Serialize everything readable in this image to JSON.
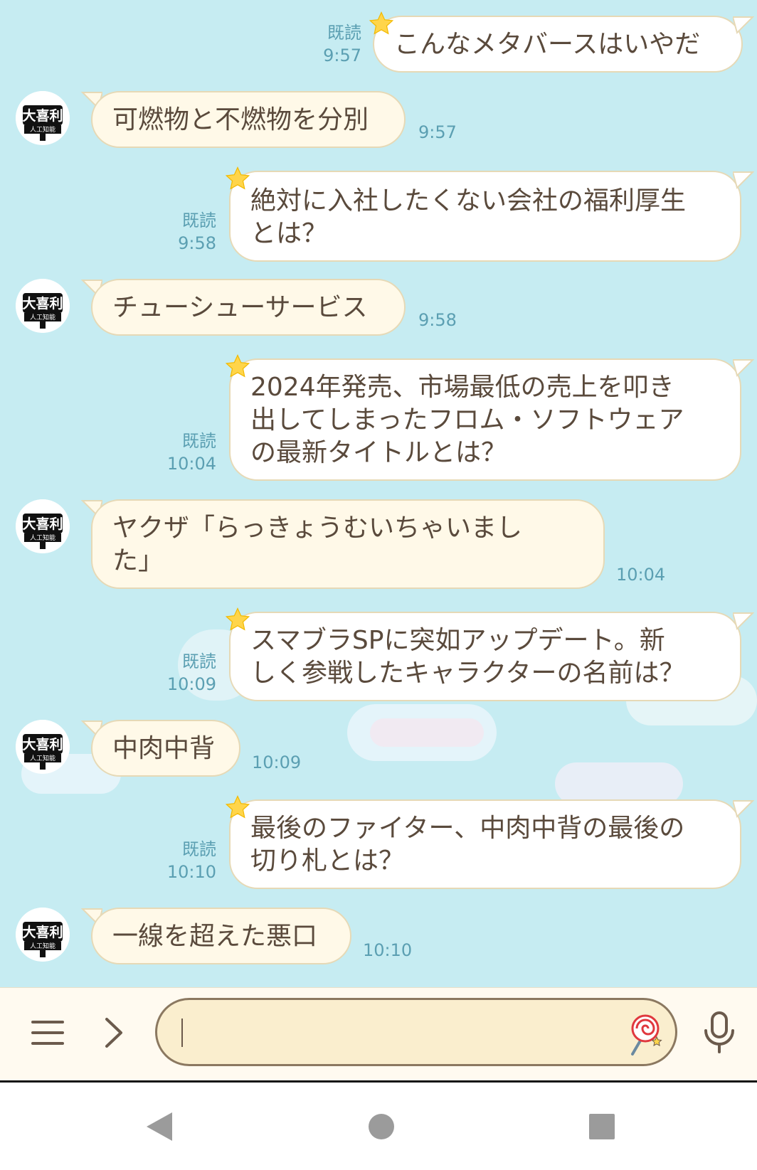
{
  "messages": [
    {
      "dir": "out",
      "lines": [
        "こんなメタバースはいやだ"
      ],
      "read": "既読",
      "time": "9:57"
    },
    {
      "dir": "in",
      "lines": [
        "可燃物と不燃物を分別"
      ],
      "time": "9:57"
    },
    {
      "dir": "out",
      "lines": [
        "絶対に入社したくない会社の福利厚生",
        "とは？"
      ],
      "read": "既読",
      "time": "9:58"
    },
    {
      "dir": "in",
      "lines": [
        "チューシューサービス"
      ],
      "time": "9:58"
    },
    {
      "dir": "out",
      "lines": [
        "2024年発売、市場最低の売上を叩き",
        "出してしまったフロム・ソフトウェア",
        "の最新タイトルとは？"
      ],
      "read": "既読",
      "time": "10:04"
    },
    {
      "dir": "in",
      "lines": [
        "ヤクザ「らっきょうむいちゃいまし",
        "た」"
      ],
      "time": "10:04"
    },
    {
      "dir": "out",
      "lines": [
        "スマブラSPに突如アップデート。新",
        "しく参戦したキャラクターの名前は？"
      ],
      "read": "既読",
      "time": "10:09"
    },
    {
      "dir": "in",
      "lines": [
        "中肉中背"
      ],
      "time": "10:09"
    },
    {
      "dir": "out",
      "lines": [
        "最後のファイター、中肉中背の最後の",
        "切り札とは？"
      ],
      "read": "既読",
      "time": "10:10"
    },
    {
      "dir": "in",
      "lines": [
        "一線を超えた悪口"
      ],
      "time": "10:10"
    }
  ],
  "avatar": {
    "logo_text": "大喜利",
    "sub_text": "人工知能"
  },
  "input": {
    "placeholder": "",
    "menu_icon": "menu-icon",
    "expand_icon": "chevron-right-icon",
    "sticker_icon": "lollipop-icon",
    "mic_icon": "microphone-icon"
  },
  "navigation": {
    "back": "back-icon",
    "home": "home-icon",
    "recents": "recents-icon"
  },
  "colors": {
    "background": "#c6ecf2",
    "incoming_bubble": "#fff9e8",
    "outgoing_bubble": "#ffffff",
    "text": "#5a4a3c",
    "meta": "#5b9fb2"
  }
}
